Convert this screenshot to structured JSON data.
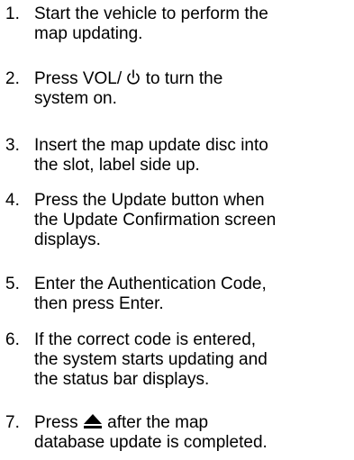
{
  "steps": [
    {
      "number": "1.",
      "lines": [
        "Start the vehicle to perform the",
        "map updating."
      ]
    },
    {
      "number": "2.",
      "line1_before_icon": "Press VOL/ ",
      "icon": "power-icon",
      "line1_after_icon": " to turn the",
      "line2": "system on."
    },
    {
      "number": "3.",
      "lines": [
        "Insert the map update disc into",
        "the slot, label side up."
      ]
    },
    {
      "number": "4.",
      "lines": [
        "Press the Update button when",
        "the Update Confirmation screen",
        "displays."
      ]
    },
    {
      "number": "5.",
      "lines": [
        "Enter the Authentication Code,",
        "then press Enter."
      ]
    },
    {
      "number": "6.",
      "lines": [
        "If the correct code is entered,",
        "the system starts updating and",
        "the status bar displays."
      ]
    },
    {
      "number": "7.",
      "line1_before_icon": "Press ",
      "icon": "eject-icon",
      "line1_after_icon": " after the map",
      "line2": "database update is completed."
    }
  ]
}
